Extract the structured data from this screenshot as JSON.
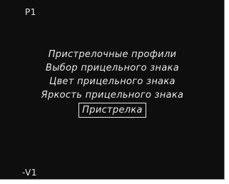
{
  "indicators": {
    "top": "P1",
    "bottom": "-V1"
  },
  "menu": {
    "items": [
      {
        "label": "Пристрелочные профили"
      },
      {
        "label": "Выбор прицельного знака"
      },
      {
        "label": "Цвет прицельного знака"
      },
      {
        "label": "Яркость прицельного знака"
      },
      {
        "label": "Пристрелка",
        "selected": true
      }
    ]
  },
  "colors": {
    "background": "#0e0e0e",
    "text": "#e8e8e8"
  }
}
